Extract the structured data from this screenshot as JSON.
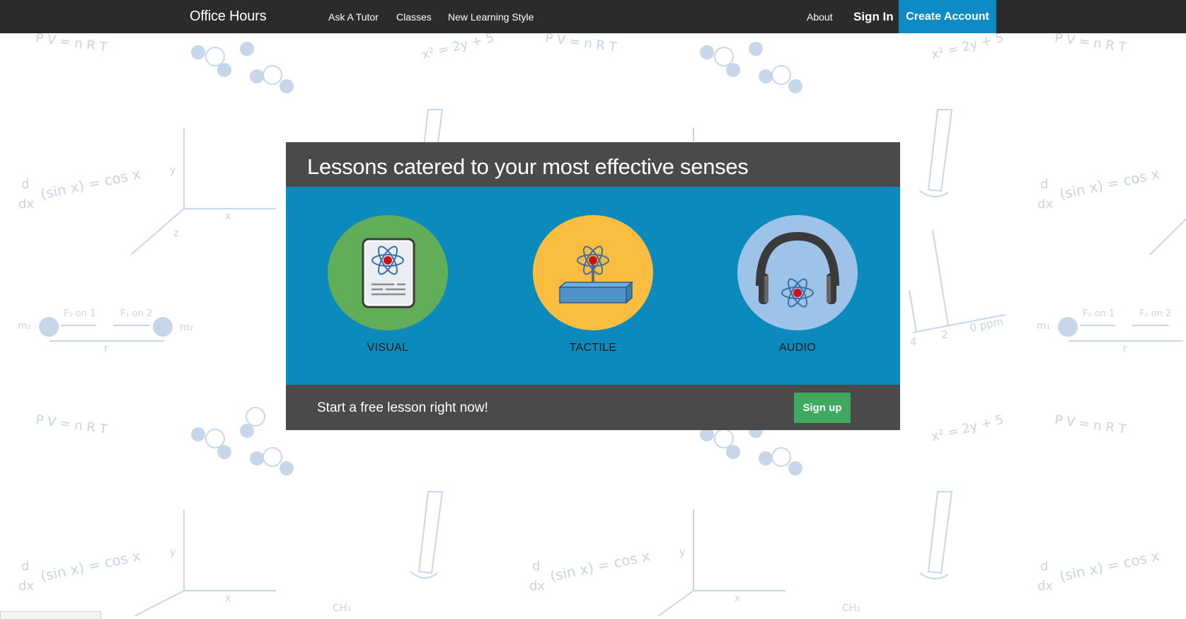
{
  "navbar": {
    "brand": "Office Hours",
    "links": [
      "Ask A Tutor",
      "Classes",
      "New Learning Style"
    ],
    "about": "About",
    "sign_in": "Sign In",
    "create_account": "Create Account"
  },
  "hero": {
    "title": "Lessons catered to your most effective senses",
    "senses": [
      {
        "label": "VISUAL",
        "icon": "document-atom-icon",
        "color": "#62ad57"
      },
      {
        "label": "TACTILE",
        "icon": "atom-block-icon",
        "color": "#fbbd3f"
      },
      {
        "label": "AUDIO",
        "icon": "headphones-atom-icon",
        "color": "#9dc4e8"
      }
    ],
    "cta_text": "Start a free lesson right now!",
    "signup_label": "Sign up"
  },
  "background": {
    "formulas": {
      "ideal_gas": "P V = n R T",
      "quadratic": "x² = 2y + 5",
      "derivative": "(sin x) = cos x",
      "d": "d",
      "dx": "dx",
      "m1": "m₁",
      "m2": "m₂",
      "f21": "F₂ on 1",
      "f12": "F₁ on 2",
      "r": "r",
      "axis_x": "x",
      "axis_y": "y",
      "axis_z": "z",
      "ppm": "0  ppm",
      "tick_2": "2",
      "tick_4": "4",
      "ch3": "CH₃"
    }
  },
  "colors": {
    "navbar": "#2b2b2b",
    "accent": "#0e8bc4",
    "card_body": "#0a8abd",
    "card_header": "#4a4a4a",
    "signup": "#3faa5f",
    "pattern": "#c6d4e6"
  }
}
